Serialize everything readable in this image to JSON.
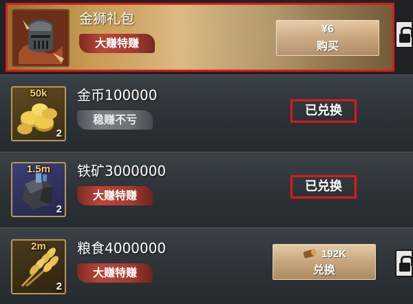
{
  "colors": {
    "gold_row": "#c79d54",
    "highlight_border": "#e01818",
    "tag_red": "#b9453a",
    "tag_grey": "#7a8086",
    "tier_text": "#ffd36a"
  },
  "rows": [
    {
      "icon": "iron-helmet-icon",
      "title": "金狮礼包",
      "tag": "大赚特赚",
      "button": {
        "price": "¥6",
        "label": "购买"
      }
    },
    {
      "icon": "gold-coins-icon",
      "tier": "50k",
      "count": "2",
      "title": "金币100000",
      "tag": "稳赚不亏",
      "status": "已兑换"
    },
    {
      "icon": "iron-ore-icon",
      "tier": "1.5m",
      "count": "2",
      "title": "铁矿3000000",
      "tag": "大赚特赚",
      "status": "已兑换"
    },
    {
      "icon": "wheat-icon",
      "tier": "2m",
      "count": "2",
      "title": "粮食4000000",
      "tag": "大赚特赚",
      "button": {
        "cost": "192K",
        "cost_icon": "wood-log-icon",
        "label": "兑换"
      }
    }
  ]
}
